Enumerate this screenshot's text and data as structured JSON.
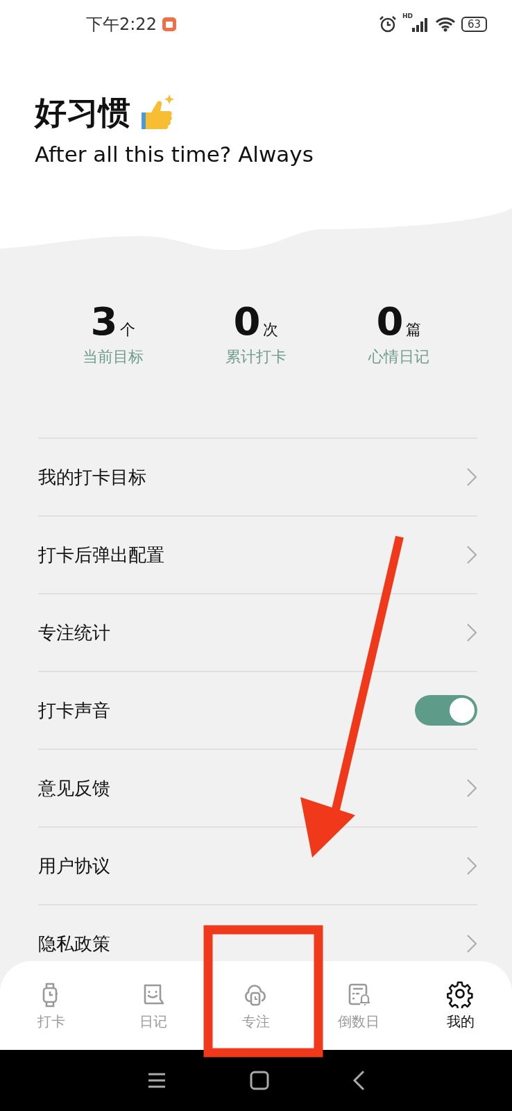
{
  "status_bar": {
    "time": "下午2:22",
    "network": "HD",
    "battery": "63"
  },
  "header": {
    "title": "好习惯",
    "subtitle": "After all this time? Always"
  },
  "stats": [
    {
      "value": "3",
      "unit": "个",
      "label": "当前目标"
    },
    {
      "value": "0",
      "unit": "次",
      "label": "累计打卡"
    },
    {
      "value": "0",
      "unit": "篇",
      "label": "心情日记"
    }
  ],
  "menu": [
    {
      "kind": "link",
      "label": "我的打卡目标"
    },
    {
      "kind": "link",
      "label": "打卡后弹出配置"
    },
    {
      "kind": "link",
      "label": "专注统计"
    },
    {
      "kind": "toggle",
      "label": "打卡声音",
      "on": true
    },
    {
      "kind": "link",
      "label": "意见反馈"
    },
    {
      "kind": "link",
      "label": "用户协议"
    },
    {
      "kind": "link",
      "label": "隐私政策"
    }
  ],
  "tabs": [
    {
      "label": "打卡",
      "selected": false
    },
    {
      "label": "日记",
      "selected": false
    },
    {
      "label": "专注",
      "selected": false
    },
    {
      "label": "倒数日",
      "selected": false
    },
    {
      "label": "我的",
      "selected": true
    }
  ]
}
